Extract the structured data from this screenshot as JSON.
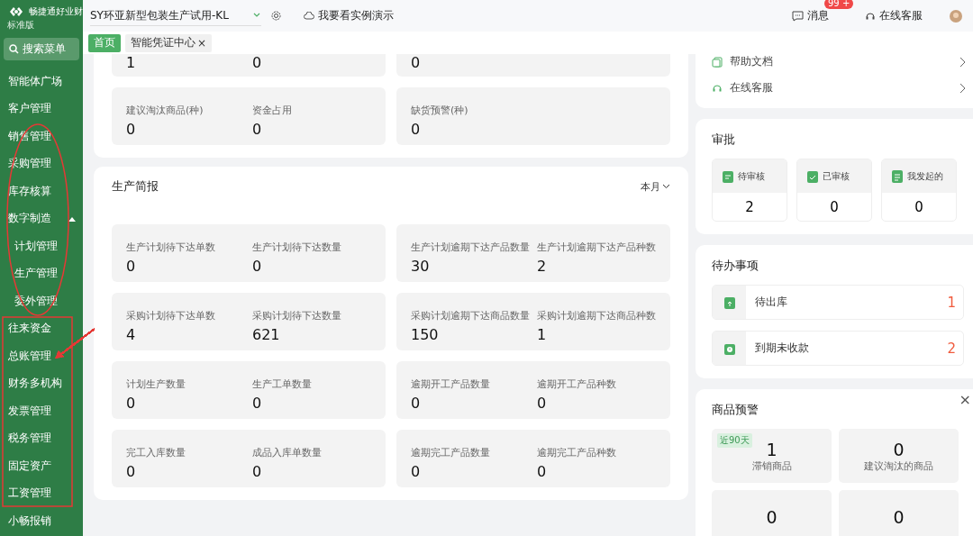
{
  "brand": {
    "name": "畅捷通好业财",
    "edition": "标准版"
  },
  "search_menu": "搜索菜单",
  "sidebar": {
    "items": [
      {
        "label": "智能体广场"
      },
      {
        "label": "客户管理"
      },
      {
        "label": "销售管理"
      },
      {
        "label": "采购管理"
      },
      {
        "label": "库存核算"
      },
      {
        "label": "数字制造",
        "expanded": true,
        "children": [
          {
            "label": "计划管理"
          },
          {
            "label": "生产管理"
          },
          {
            "label": "委外管理"
          }
        ]
      },
      {
        "label": "往来资金"
      },
      {
        "label": "总账管理"
      },
      {
        "label": "财务多机构"
      },
      {
        "label": "发票管理"
      },
      {
        "label": "税务管理"
      },
      {
        "label": "固定资产"
      },
      {
        "label": "工资管理"
      },
      {
        "label": "小畅报销"
      }
    ]
  },
  "topbar": {
    "company": "SY环亚新型包装生产试用-KL",
    "demo": "我要看实例演示",
    "messages": "消息",
    "badge": "99 +",
    "service": "在线客服"
  },
  "tabs": [
    {
      "label": "首页",
      "selected": true
    },
    {
      "label": "智能凭证中心",
      "selected": false,
      "close": "×"
    }
  ],
  "stock_card": {
    "rows": [
      [
        {
          "metrics": [
            {
              "value": "1"
            },
            {
              "value": "0"
            }
          ]
        },
        {
          "metrics": [
            {
              "value": "0"
            }
          ]
        }
      ],
      [
        {
          "metrics": [
            {
              "label": "建议淘汰商品(种)",
              "value": "0"
            },
            {
              "label": "资金占用",
              "value": "0"
            }
          ]
        },
        {
          "metrics": [
            {
              "label": "缺货预警(种)",
              "value": "0"
            }
          ]
        }
      ]
    ]
  },
  "production": {
    "title": "生产简报",
    "period": "本月",
    "rows": [
      [
        {
          "metrics": [
            {
              "label": "生产计划待下达单数",
              "value": "0"
            },
            {
              "label": "生产计划待下达数量",
              "value": "0"
            }
          ]
        },
        {
          "metrics": [
            {
              "label": "生产计划逾期下达产品数量",
              "value": "30"
            },
            {
              "label": "生产计划逾期下达产品种数",
              "value": "2"
            }
          ]
        }
      ],
      [
        {
          "metrics": [
            {
              "label": "采购计划待下达单数",
              "value": "4"
            },
            {
              "label": "采购计划待下达数量",
              "value": "621"
            }
          ]
        },
        {
          "metrics": [
            {
              "label": "采购计划逾期下达商品数量",
              "value": "150"
            },
            {
              "label": "采购计划逾期下达商品种数",
              "value": "1"
            }
          ]
        }
      ],
      [
        {
          "metrics": [
            {
              "label": "计划生产数量",
              "value": "0"
            },
            {
              "label": "生产工单数量",
              "value": "0"
            }
          ]
        },
        {
          "metrics": [
            {
              "label": "逾期开工产品数量",
              "value": "0"
            },
            {
              "label": "逾期开工产品种数",
              "value": "0"
            }
          ]
        }
      ],
      [
        {
          "metrics": [
            {
              "label": "完工入库数量",
              "value": "0"
            },
            {
              "label": "成品入库单数量",
              "value": "0"
            }
          ]
        },
        {
          "metrics": [
            {
              "label": "逾期完工产品数量",
              "value": "0"
            },
            {
              "label": "逾期完工产品种数",
              "value": "0"
            }
          ]
        }
      ]
    ]
  },
  "help": {
    "links": [
      {
        "kind": "docs",
        "label": "帮助文档"
      },
      {
        "kind": "service",
        "label": "在线客服"
      }
    ]
  },
  "approval": {
    "title": "审批",
    "items": [
      {
        "kind": "pending",
        "label": "待审核",
        "value": "2"
      },
      {
        "kind": "approved",
        "label": "已审核",
        "value": "0"
      },
      {
        "kind": "mine",
        "label": "我发起的",
        "value": "0"
      }
    ]
  },
  "todo": {
    "title": "待办事项",
    "items": [
      {
        "kind": "outbound",
        "label": "待出库",
        "value": "1"
      },
      {
        "kind": "overdue",
        "label": "到期未收款",
        "value": "2"
      }
    ]
  },
  "goods_alert": {
    "title": "商品预警",
    "close": "×",
    "items": [
      {
        "tag": "近90天",
        "value": "1",
        "label": "滞销商品"
      },
      {
        "value": "0",
        "label": "建议淘汰的商品"
      },
      {
        "value": "0"
      },
      {
        "value": "0"
      }
    ]
  },
  "annotations": [
    {
      "kind": "ellipse",
      "color": "#e53935"
    },
    {
      "kind": "box",
      "color": "#e53935"
    },
    {
      "kind": "arrow",
      "color": "#e53935"
    }
  ]
}
